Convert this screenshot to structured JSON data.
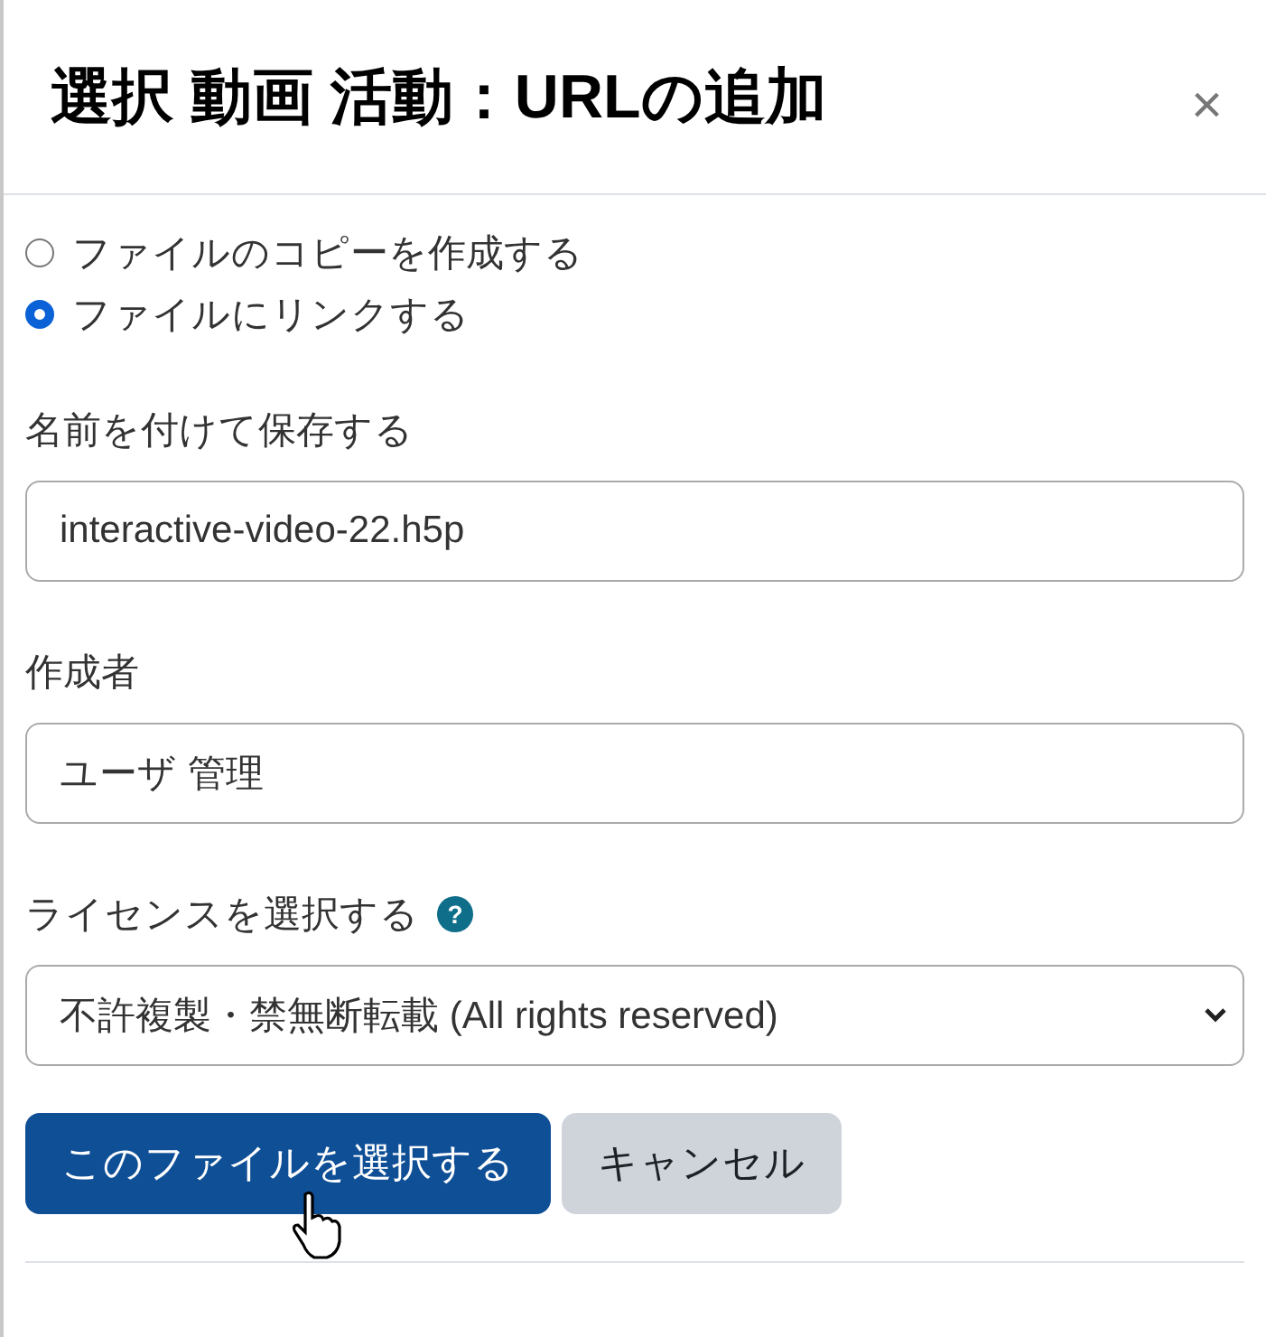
{
  "dialog": {
    "title": "選択 動画 活動：URLの追加",
    "close": "×"
  },
  "options": [
    {
      "label": "ファイルのコピーを作成する",
      "selected": false
    },
    {
      "label": "ファイルにリンクする",
      "selected": true
    }
  ],
  "fields": [
    {
      "kind": "text",
      "label": "名前を付けて保存する",
      "value": "interactive-video-22.h5p"
    },
    {
      "kind": "text",
      "label": "作成者",
      "value": "ユーザ 管理"
    },
    {
      "kind": "select",
      "label": "ライセンスを選択する",
      "help": "?",
      "value": "不許複製・禁無断転載 (All rights reserved)"
    }
  ],
  "buttons": [
    {
      "label": "このファイルを選択する",
      "kind": "primary"
    },
    {
      "label": "キャンセル",
      "kind": "secondary"
    }
  ]
}
